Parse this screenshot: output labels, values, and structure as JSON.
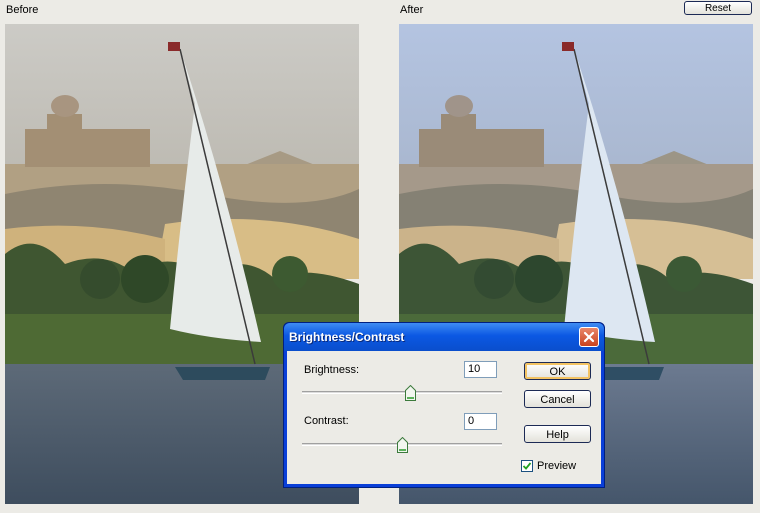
{
  "labels": {
    "before": "Before",
    "after": "After"
  },
  "toolbar": {
    "reset_label": "Reset"
  },
  "dialog": {
    "title": "Brightness/Contrast",
    "brightness": {
      "label": "Brightness:",
      "value": "10"
    },
    "contrast": {
      "label": "Contrast:",
      "value": "0"
    },
    "buttons": {
      "ok": "OK",
      "cancel": "Cancel",
      "help": "Help"
    },
    "preview": {
      "label": "Preview",
      "checked": true
    },
    "icons": {
      "close": "close-icon",
      "check": "check-icon",
      "slider_thumb": "slider-thumb-icon"
    }
  },
  "colors": {
    "title_bar": "#0b58e3",
    "close_button": "#c9421e",
    "dialog_bg": "#ecebe6"
  }
}
